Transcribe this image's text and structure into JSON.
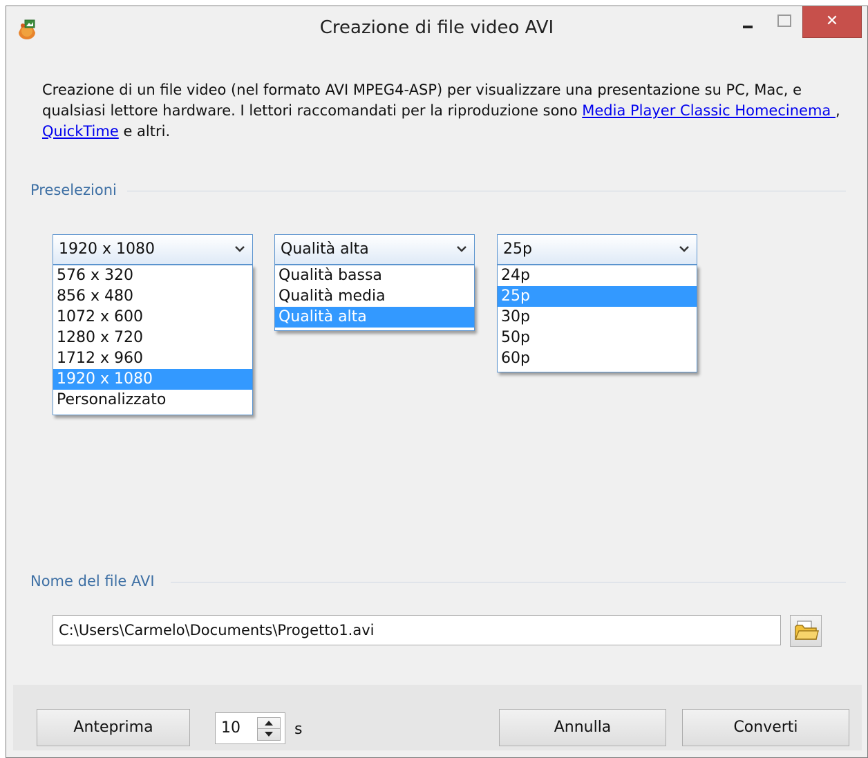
{
  "window": {
    "title": "Creazione di file video AVI",
    "close_glyph": "✕"
  },
  "description": {
    "text_part1": "Creazione di un file video (nel formato AVI MPEG4-ASP) per visualizzare una presentazione su PC, Mac, e qualsiasi lettore hardware. I lettori raccomandati per la riproduzione sono ",
    "link1": "Media Player Classic Homecinema ",
    "text_part2": ", ",
    "link2": "QuickTime",
    "text_part3": " e altri."
  },
  "presets": {
    "group_label": "Preselezioni",
    "resolution": {
      "selected": "1920 x 1080",
      "options": [
        "576 x 320",
        "856 x 480",
        "1072 x 600",
        "1280 x 720",
        "1712 x 960",
        "1920 x 1080",
        "Personalizzato"
      ],
      "selected_index": 5
    },
    "quality": {
      "selected": "Qualità alta",
      "options": [
        "Qualità bassa",
        "Qualità media",
        "Qualità alta"
      ],
      "selected_index": 2
    },
    "framerate": {
      "selected": "25p",
      "options": [
        "24p",
        "25p",
        "30p",
        "50p",
        "60p"
      ],
      "selected_index": 1
    }
  },
  "file": {
    "group_label": "Nome del file AVI",
    "path": "C:\\Users\\Carmelo\\Documents\\Progetto1.avi"
  },
  "footer": {
    "preview_label": "Anteprima",
    "duration_value": "10",
    "duration_unit": "s",
    "cancel_label": "Annulla",
    "convert_label": "Converti"
  },
  "colors": {
    "accent": "#3399ff",
    "group_label": "#3d6fa4",
    "link": "#0000ee",
    "close": "#c7504b"
  },
  "icons": {
    "app": "app-icon",
    "browse": "folder-open-icon",
    "chevron": "chevron-down-icon"
  }
}
